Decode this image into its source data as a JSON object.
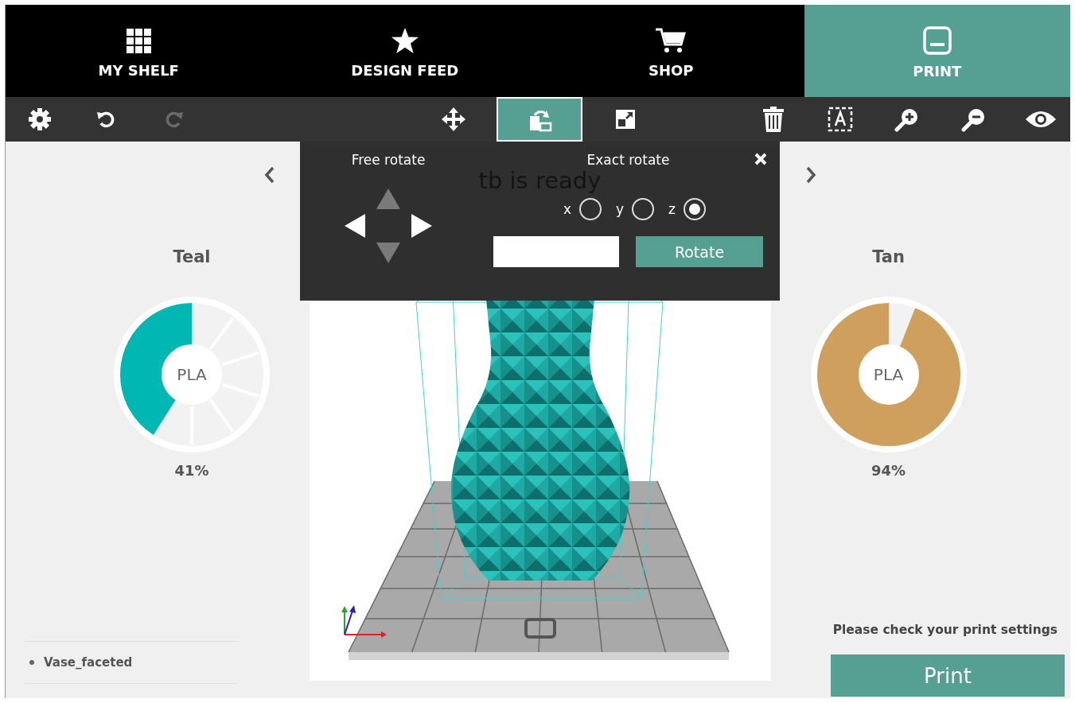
{
  "nav_tabs": [
    {
      "kind": "shelf",
      "label": "MY SHELF",
      "selected": false
    },
    {
      "kind": "feed",
      "label": "DESIGN FEED",
      "selected": false
    },
    {
      "kind": "shop",
      "label": "SHOP",
      "selected": false
    },
    {
      "kind": "print",
      "label": "PRINT",
      "selected": true
    }
  ],
  "toolbar": {
    "left": [
      {
        "kind": "settings",
        "selected": false,
        "disabled": false
      },
      {
        "kind": "undo",
        "selected": false,
        "disabled": false
      },
      {
        "kind": "redo",
        "selected": false,
        "disabled": true
      }
    ],
    "center": [
      {
        "kind": "move",
        "selected": false,
        "disabled": false
      },
      {
        "kind": "rotate",
        "selected": true,
        "disabled": false
      },
      {
        "kind": "scale",
        "selected": false,
        "disabled": false
      }
    ],
    "right": [
      {
        "kind": "delete",
        "selected": false,
        "disabled": false
      },
      {
        "kind": "text",
        "selected": false,
        "disabled": false
      },
      {
        "kind": "zoom_in",
        "selected": false,
        "disabled": false
      },
      {
        "kind": "zoom_out",
        "selected": false,
        "disabled": false
      },
      {
        "kind": "view",
        "selected": false,
        "disabled": false
      }
    ]
  },
  "status_text": "tb is ready",
  "rotate_panel": {
    "free_title": "Free rotate",
    "exact_title": "Exact rotate",
    "arrows": [
      {
        "kind": "up",
        "disabled": true
      },
      {
        "kind": "left",
        "disabled": false
      },
      {
        "kind": "right",
        "disabled": false
      },
      {
        "kind": "down",
        "disabled": true
      }
    ],
    "axes": [
      {
        "label": "x",
        "selected": false
      },
      {
        "label": "y",
        "selected": false
      },
      {
        "label": "z",
        "selected": true
      }
    ],
    "button": "Rotate"
  },
  "filaments": [
    {
      "name": "Teal",
      "material": "PLA",
      "level": 0.41,
      "reading": "41%",
      "color": "#00b7b3"
    },
    {
      "name": "Tan",
      "material": "PLA",
      "level": 0.94,
      "reading": "94%",
      "color": "#cf9f5e"
    }
  ],
  "models": [
    {
      "name": "Vase_faceted"
    }
  ],
  "print_notice": "Please check your print settings",
  "print_button": "Print"
}
